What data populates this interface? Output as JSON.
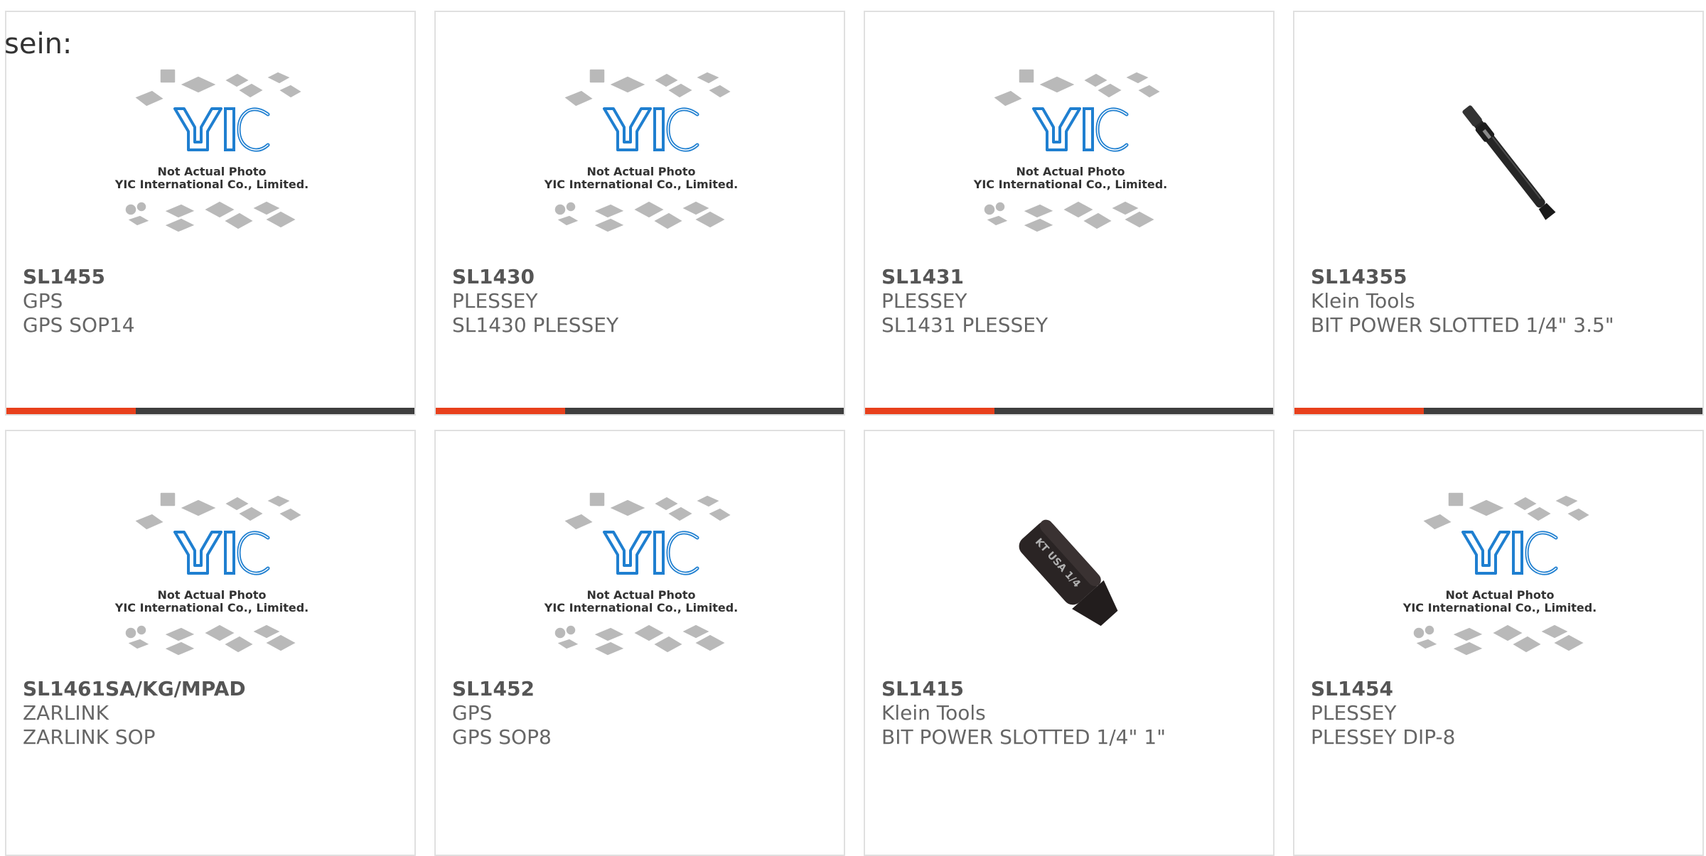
{
  "header": {
    "text": "sein:"
  },
  "colors": {
    "accent": "#e8401c",
    "bar": "#3e3e3e",
    "yic_blue": "#1f7fd0"
  },
  "products": [
    {
      "part": "SL1455",
      "maker": "GPS",
      "desc": "GPS SOP14",
      "image": "yic-placeholder",
      "caption1": "Not Actual Photo",
      "caption2": "YIC International Co., Limited."
    },
    {
      "part": "SL1430",
      "maker": "PLESSEY",
      "desc": "SL1430 PLESSEY",
      "image": "yic-placeholder",
      "caption1": "Not Actual Photo",
      "caption2": "YIC International Co., Limited."
    },
    {
      "part": "SL1431",
      "maker": "PLESSEY",
      "desc": "SL1431 PLESSEY",
      "image": "yic-placeholder",
      "caption1": "Not Actual Photo",
      "caption2": "YIC International Co., Limited."
    },
    {
      "part": "SL14355",
      "maker": "Klein Tools",
      "desc": "BIT POWER SLOTTED 1/4\" 3.5\"",
      "image": "long-screwdriver-bit"
    },
    {
      "part": "SL1461SA/KG/MPAD",
      "maker": "ZARLINK",
      "desc": "ZARLINK SOP",
      "image": "yic-placeholder",
      "caption1": "Not Actual Photo",
      "caption2": "YIC International Co., Limited."
    },
    {
      "part": "SL1452",
      "maker": "GPS",
      "desc": "GPS SOP8",
      "image": "yic-placeholder",
      "caption1": "Not Actual Photo",
      "caption2": "YIC International Co., Limited."
    },
    {
      "part": "SL1415",
      "maker": "Klein Tools",
      "desc": "BIT POWER SLOTTED 1/4\" 1\"",
      "image": "short-screwdriver-bit",
      "bit_text": "KT USA 1/4"
    },
    {
      "part": "SL1454",
      "maker": "PLESSEY",
      "desc": "PLESSEY DIP-8",
      "image": "yic-placeholder",
      "caption1": "Not Actual Photo",
      "caption2": "YIC International Co., Limited."
    }
  ]
}
